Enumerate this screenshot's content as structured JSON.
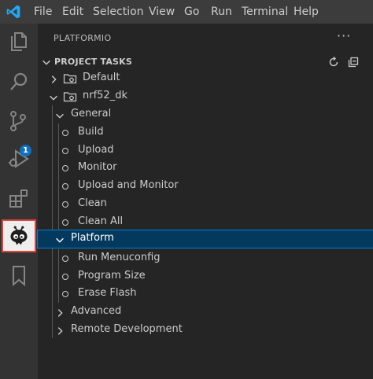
{
  "menu": [
    "File",
    "Edit",
    "Selection",
    "View",
    "Go",
    "Run",
    "Terminal",
    "Help"
  ],
  "activity": {
    "items": [
      "explorer-icon",
      "search-icon",
      "source-control-icon",
      "run-debug-icon",
      "extensions-icon",
      "platformio-icon",
      "bookmark-icon"
    ],
    "scm_badge": "1"
  },
  "sidebar": {
    "title": "PLATFORMIO",
    "more": "···",
    "section": {
      "label": "PROJECT TASKS",
      "actions": [
        "refresh-icon",
        "collapse-all-icon"
      ]
    },
    "envs": [
      {
        "label": "Default",
        "expanded": false
      },
      {
        "label": "nrf52_dk",
        "expanded": true
      }
    ],
    "groups": {
      "general": {
        "label": "General",
        "tasks": [
          "Build",
          "Upload",
          "Monitor",
          "Upload and Monitor",
          "Clean",
          "Clean All"
        ]
      },
      "platform": {
        "label": "Platform",
        "tasks": [
          "Run Menuconfig",
          "Program Size",
          "Erase Flash"
        ]
      },
      "advanced": {
        "label": "Advanced"
      },
      "remote": {
        "label": "Remote Development"
      }
    }
  },
  "colors": {
    "selection": "#04395e",
    "focus_border": "#007fd4",
    "badge": "#0e70c0",
    "highlight_box": "#e0423d"
  }
}
